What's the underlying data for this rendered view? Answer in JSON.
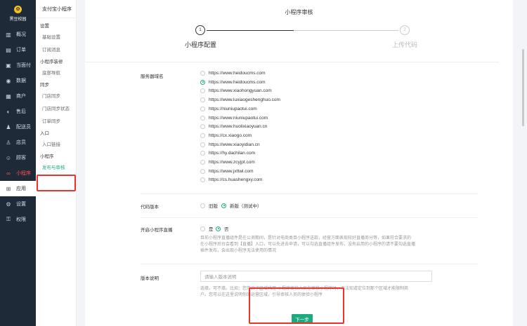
{
  "sidebar": {
    "brand": "黑豆校园",
    "items": [
      {
        "label": "概况",
        "icon": "chart-icon"
      },
      {
        "label": "订单",
        "icon": "order-icon"
      },
      {
        "label": "当面付",
        "icon": "pay-icon"
      },
      {
        "label": "数据",
        "icon": "data-icon"
      },
      {
        "label": "商户",
        "icon": "shop-icon"
      },
      {
        "label": "售后",
        "icon": "service-icon"
      },
      {
        "label": "配送员",
        "icon": "rider-icon"
      },
      {
        "label": "店员",
        "icon": "staff-icon"
      },
      {
        "label": "顾客",
        "icon": "customer-icon"
      },
      {
        "label": "小程序",
        "icon": "miniapp-icon"
      },
      {
        "label": "应用",
        "icon": "apps-icon"
      },
      {
        "label": "设置",
        "icon": "gear-icon"
      },
      {
        "label": "权限",
        "icon": "permission-icon"
      }
    ]
  },
  "subnav": {
    "title": "支付宝小程序",
    "groups": [
      {
        "label": "设置",
        "items": [
          "基础设置",
          "订阅消息"
        ]
      },
      {
        "label": "小程序装修",
        "items": [
          "底部导航"
        ]
      },
      {
        "label": "同步",
        "items": [
          "门店同步",
          "门店同步状态",
          "订单同步"
        ]
      },
      {
        "label": "入口",
        "items": [
          "入口链接"
        ]
      },
      {
        "label": "小程序",
        "items": [
          "发布与审核"
        ]
      }
    ]
  },
  "main": {
    "title": "小程序审核",
    "steps": [
      {
        "num": "1",
        "label": "小程序配置"
      },
      {
        "num": "2",
        "label": "上传代码"
      }
    ],
    "domain_label": "服务器域名",
    "domains": [
      "https://www.heidoucms.com",
      "https://www.heidoucms.com",
      "https://www.xiaohongyuan.com",
      "https://www.luxiaogeshenghuo.com",
      "https://niuniupaotui.com",
      "https://www.niuniupaotui.com",
      "https://www.huolixiaoyuan.cn",
      "https://cx.xiaogo.com",
      "https://www.xiaoyidian.cn",
      "https://hy.dachilan.com",
      "https://www.zcyjpt.com",
      "https://www.jxttwl.com",
      "https://cs.huashengxy.com"
    ],
    "selected_domain": 1,
    "version_label": "代码版本",
    "version_options": [
      "旧版",
      "新版（测试中）"
    ],
    "live_label": "开启小程序直播",
    "live_options": [
      "是",
      "否"
    ],
    "live_hint_1": "目前小程序直播组件是在公测期间，是针对电商类目小程序送款，经营方面表现较好直播商分等，如果符合要求的",
    "live_hint_2": "在小程序后台会看到【直播】入口，可以先进去申请，可以勾选直播组件发布，没有启用的小程序的请不要勾选直播",
    "live_hint_3": "插件发布，会出现小程序无法使用的情况",
    "desc_label": "版本说明",
    "desc_placeholder": "请输入版本说明",
    "desc_hint_1": "选填，可不填。比如：您开启了区域代理·小程序审核人员在审核小程序时，无法知道定位到那个区域才能限制商",
    "desc_hint_2": "户。您可以在这里说明你的运营区域，引导审核人员的体验小程序",
    "next_label": "下一步"
  }
}
